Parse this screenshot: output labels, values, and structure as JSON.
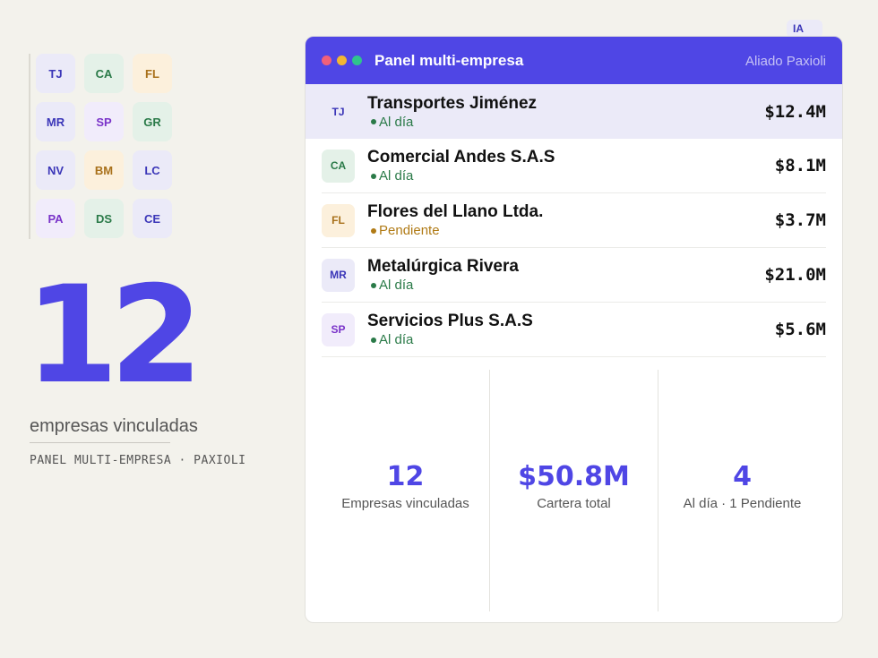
{
  "logo_grid": [
    {
      "initials": "TJ",
      "bg": "#ebeaf8",
      "fg": "#3b36b8"
    },
    {
      "initials": "CA",
      "bg": "#e4f1e8",
      "fg": "#2a7a48"
    },
    {
      "initials": "FL",
      "bg": "#fcf0dc",
      "fg": "#a8701a"
    },
    {
      "initials": "MR",
      "bg": "#ebeaf8",
      "fg": "#3b36b8"
    },
    {
      "initials": "SP",
      "bg": "#f1ecfb",
      "fg": "#7a33c9"
    },
    {
      "initials": "GR",
      "bg": "#e4f1e8",
      "fg": "#2a7a48"
    },
    {
      "initials": "NV",
      "bg": "#ebeaf8",
      "fg": "#3b36b8"
    },
    {
      "initials": "BM",
      "bg": "#fcf0dc",
      "fg": "#a8701a"
    },
    {
      "initials": "LC",
      "bg": "#ebeaf8",
      "fg": "#3b36b8"
    },
    {
      "initials": "PA",
      "bg": "#f1ecfb",
      "fg": "#7a33c9"
    },
    {
      "initials": "DS",
      "bg": "#e4f1e8",
      "fg": "#2a7a48"
    },
    {
      "initials": "CE",
      "bg": "#ebeaf8",
      "fg": "#3b36b8"
    }
  ],
  "hero": {
    "number": "12",
    "label": "empresas vinculadas",
    "subtitle": "PANEL MULTI-EMPRESA · PAXIOLI"
  },
  "badge": "IA",
  "panel": {
    "title": "Panel multi-empresa",
    "user": "Aliado Paxioli",
    "dots": [
      "#f0607a",
      "#f2b633",
      "#2fc48d"
    ],
    "rows": [
      {
        "initials": "TJ",
        "name": "Transportes Jiménez",
        "status": "Al día",
        "status_color": "#2a7a48",
        "amount": "$12.4M",
        "bg": "#ebeaf8",
        "fg": "#3b36b8",
        "active": true
      },
      {
        "initials": "CA",
        "name": "Comercial Andes S.A.S",
        "status": "Al día",
        "status_color": "#2a7a48",
        "amount": "$8.1M",
        "bg": "#e4f1e8",
        "fg": "#2a7a48",
        "active": false
      },
      {
        "initials": "FL",
        "name": "Flores del Llano Ltda.",
        "status": "Pendiente",
        "status_color": "#b07a15",
        "amount": "$3.7M",
        "bg": "#fcf0dc",
        "fg": "#a8701a",
        "active": false
      },
      {
        "initials": "MR",
        "name": "Metalúrgica Rivera",
        "status": "Al día",
        "status_color": "#2a7a48",
        "amount": "$21.0M",
        "bg": "#ebeaf8",
        "fg": "#3b36b8",
        "active": false
      },
      {
        "initials": "SP",
        "name": "Servicios Plus S.A.S",
        "status": "Al día",
        "status_color": "#2a7a48",
        "amount": "$5.6M",
        "bg": "#f1ecfb",
        "fg": "#7a33c9",
        "active": false
      }
    ],
    "stats": [
      {
        "value": "12",
        "label": "Empresas vinculadas"
      },
      {
        "value": "$50.8M",
        "label": "Cartera total"
      },
      {
        "value": "4",
        "label": "Al día · 1 Pendiente"
      }
    ]
  },
  "accent": "#4f46e5"
}
